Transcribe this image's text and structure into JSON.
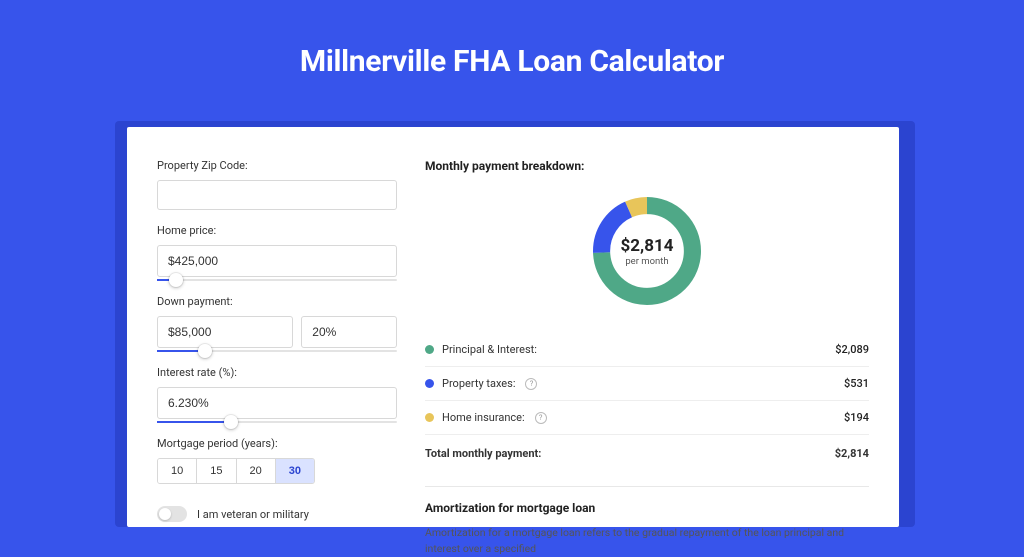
{
  "page": {
    "title": "Millnerville FHA Loan Calculator"
  },
  "form": {
    "zip": {
      "label": "Property Zip Code:",
      "value": ""
    },
    "home_price": {
      "label": "Home price:",
      "value": "$425,000",
      "slider_pct": 8
    },
    "down_payment": {
      "label": "Down payment:",
      "value": "$85,000",
      "pct": "20%",
      "slider_pct": 20
    },
    "interest_rate": {
      "label": "Interest rate (%):",
      "value": "6.230%",
      "slider_pct": 31
    },
    "period": {
      "label": "Mortgage period (years):",
      "options": [
        "10",
        "15",
        "20",
        "30"
      ],
      "selected": "30"
    },
    "veteran": {
      "label": "I am veteran or military",
      "value": false
    }
  },
  "breakdown": {
    "title": "Monthly payment breakdown:",
    "total_value": "$2,814",
    "total_sub": "per month",
    "items": [
      {
        "label": "Principal & Interest:",
        "value": "$2,089",
        "color": "green",
        "help": false
      },
      {
        "label": "Property taxes:",
        "value": "$531",
        "color": "blue",
        "help": true
      },
      {
        "label": "Home insurance:",
        "value": "$194",
        "color": "yellow",
        "help": true
      }
    ],
    "total_row": {
      "label": "Total monthly payment:",
      "value": "$2,814"
    }
  },
  "chart_data": {
    "type": "pie",
    "title": "Monthly payment breakdown",
    "categories": [
      "Principal & Interest",
      "Property taxes",
      "Home insurance"
    ],
    "values": [
      2089,
      531,
      194
    ],
    "colors": [
      "#4fa887",
      "#3754eb",
      "#e8c55a"
    ],
    "center_label": "$2,814",
    "center_sub": "per month"
  },
  "amortization": {
    "title": "Amortization for mortgage loan",
    "text": "Amortization for a mortgage loan refers to the gradual repayment of the loan principal and interest over a specified"
  }
}
